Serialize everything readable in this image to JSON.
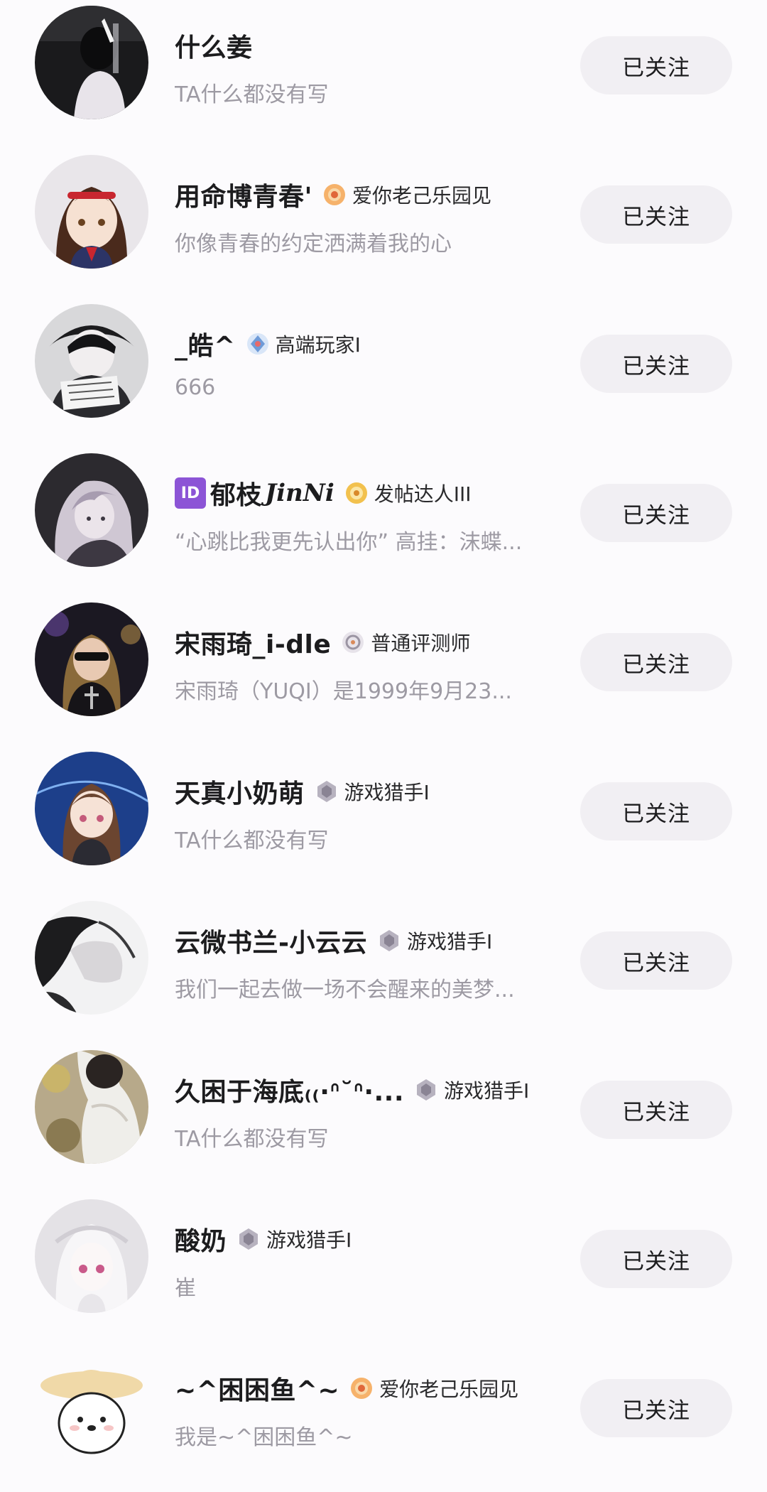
{
  "follow_button_label": "已关注",
  "users": [
    {
      "name": "什么姜",
      "badge": "",
      "badge_icon": "",
      "bio": "TA什么都没有写"
    },
    {
      "name": "用命博青春'",
      "badge": "爱你老己乐园见",
      "badge_icon": "orange-sun-badge-icon",
      "bio": "你像青春的约定洒满着我的心"
    },
    {
      "name": "_皓^",
      "badge": "高端玩家I",
      "badge_icon": "blue-crystal-badge-icon",
      "bio": "666"
    },
    {
      "name": "郁枝",
      "name_prefix": "ID",
      "name_script": "JinNi",
      "badge": "发帖达人III",
      "badge_icon": "gold-sun-badge-icon",
      "bio": "“心跳比我更先认出你” 高挂：沫蝶..."
    },
    {
      "name": "宋雨琦_i-dle",
      "badge": "普通评测师",
      "badge_icon": "gray-ring-badge-icon",
      "bio": "宋雨琦（YUQI）是1999年9月23..."
    },
    {
      "name": "天真小奶萌",
      "badge": "游戏猎手I",
      "badge_icon": "gray-gem-badge-icon",
      "bio": "TA什么都没有写"
    },
    {
      "name": "云微书兰-小云云",
      "badge": "游戏猎手I",
      "badge_icon": "gray-gem-badge-icon",
      "bio": "我们一起去做一场不会醒来的美梦..."
    },
    {
      "name": "久困于海底₍₍·ᐢ˘ᐢ·...",
      "badge": "游戏猎手I",
      "badge_icon": "gray-gem-badge-icon",
      "bio": "TA什么都没有写"
    },
    {
      "name": "酸奶",
      "badge": "游戏猎手I",
      "badge_icon": "gray-gem-badge-icon",
      "bio": "崔"
    },
    {
      "name": "~^困困鱼^~",
      "badge": "爱你老己乐园见",
      "badge_icon": "orange-sun-badge-icon",
      "bio": "我是~^困困鱼^~"
    }
  ]
}
